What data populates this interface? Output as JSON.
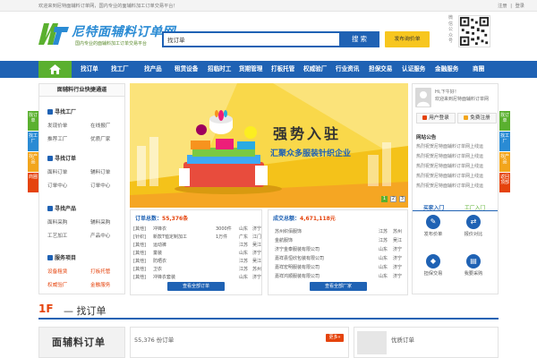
{
  "topbar": {
    "welcome": "欢迎来到尼特面辅料订单网，国内专业的面辅料加工订单交易平台！",
    "register": "注册",
    "sep": "|",
    "login": "登录"
  },
  "header": {
    "logo_title": "尼特面辅料订单网",
    "logo_subtitle": "国内专业的面辅料加工订单交易平台",
    "search_value": "找订单",
    "search_button": "搜索",
    "post_button": "发布询价单",
    "qr_label": "微信公众号"
  },
  "nav": {
    "items": [
      "找订单",
      "找工厂",
      "找产品",
      "租赁设备",
      "招临时工",
      "货期管理",
      "打板托管",
      "权威验厂",
      "行业资讯",
      "担保交易",
      "认证服务",
      "金融服务",
      "商圈"
    ]
  },
  "left_tabs": [
    "找订单",
    "找工厂",
    "找产品",
    "商圈"
  ],
  "right_tabs": [
    "找订单",
    "找工厂",
    "找产品",
    "返回顶部"
  ],
  "side_menu": {
    "title": "面辅料行业快捷通道",
    "sections": [
      {
        "title": "寻找工厂",
        "links": [
          "发现价单",
          "在线报厂",
          "推荐工厂",
          "优质厂家"
        ]
      },
      {
        "title": "寻找订单",
        "links": [
          "面料订单",
          "辅料订单",
          "订单中心",
          "订单中心"
        ]
      },
      {
        "title": "寻找产品",
        "links": [
          "面料采购",
          "辅料采购",
          "工艺加工",
          "产品中心"
        ]
      },
      {
        "title": "服务项目",
        "links": [
          "设备租赁",
          "打板托管",
          "权威验厂",
          "金融服务"
        ]
      }
    ]
  },
  "banner": {
    "caption": "强势入驻",
    "subtitle": "汇聚众多服装针织企业",
    "dots": [
      "1",
      "2",
      "3"
    ]
  },
  "orders": {
    "label": "订单总数：",
    "total": "55,376条",
    "rows": [
      [
        "[其他]",
        "冲锋衣",
        "3000件",
        "山东",
        "济宁"
      ],
      [
        "[针织]",
        "新款T恤定制加工",
        "1万件",
        "广东",
        "江门"
      ],
      [
        "[其他]",
        "运动裤",
        "",
        "江苏",
        "吴江"
      ],
      [
        "[其他]",
        "童装",
        "",
        "山东",
        "济宁"
      ],
      [
        "[其他]",
        "防晒衣",
        "",
        "江苏",
        "吴江"
      ],
      [
        "[其他]",
        "卫衣",
        "",
        "江苏",
        "苏州"
      ],
      [
        "[其他]",
        "冲锋衣套装",
        "",
        "山东",
        "济宁"
      ]
    ],
    "button": "查看全部订单"
  },
  "deals": {
    "label": "成交总额：",
    "total": "4,671,118元",
    "rows": [
      [
        "苏州织佰服饰",
        "江苏",
        "苏州"
      ],
      [
        "金航服饰",
        "江苏",
        "吴江"
      ],
      [
        "济宁金泰服装有限公司",
        "山东",
        "济宁"
      ],
      [
        "嘉祥县恒欣包装有限公司",
        "山东",
        "济宁"
      ],
      [
        "嘉祥宏明服装有限公司",
        "山东",
        "济宁"
      ],
      [
        "嘉祥鸿顺服装有限公司",
        "山东",
        "济宁"
      ]
    ],
    "button": "查看全部厂家"
  },
  "user_panel": {
    "greeting": "Hi,下午好！",
    "welcome": "欢迎来到尼特面辅料订单网",
    "login_button": "用户登录",
    "register_button": "免费注册",
    "notice_title": "网站公告",
    "notices": [
      "热烈祝贺尼特面辅料订单网上线运",
      "热烈祝贺尼特面辅料订单网上线运",
      "热烈祝贺尼特面辅料订单网上线运",
      "热烈祝贺尼特面辅料订单网上线运",
      "热烈祝贺尼特面辅料订单网上线运"
    ],
    "tabs": [
      "买家入门",
      "工厂入门"
    ],
    "grid": [
      "发布价单",
      "报价对比",
      "担保交易",
      "我要采购"
    ]
  },
  "floor": {
    "number": "1F",
    "title": "— 找订单"
  },
  "bottom": {
    "left_title": "面辅料订单",
    "count": "55,376 份订单",
    "more": "更多»",
    "right_title": "优质订单"
  },
  "colors": {
    "nav_blue": "#1f62b4",
    "accent_green": "#5ab02f",
    "accent_orange": "#e5430c",
    "post_yellow": "#f7c61f"
  }
}
